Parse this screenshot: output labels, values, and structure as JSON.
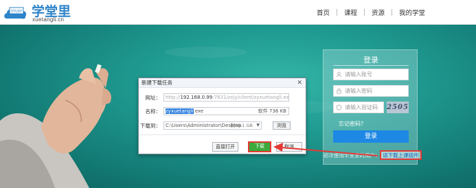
{
  "header": {
    "logo_badge": "STUDY",
    "logo_title": "学堂里",
    "logo_domain": "xuetangli.cn",
    "nav": [
      "首页",
      "课程",
      "资源",
      "我的学堂"
    ]
  },
  "login": {
    "title": "登录",
    "account_placeholder": "请输入账号",
    "password_placeholder": "请输入密码",
    "captcha_placeholder": "请输入验证码",
    "captcha_text": "2505",
    "forgot": "忘记密码？",
    "login_button": "登录",
    "first_use": "初次使用学堂里的用户：",
    "plugin_link": "请下载上课插件"
  },
  "dialog": {
    "title": "新建下载任务",
    "url_label": "网址：",
    "url_prefix": "http://",
    "url_host": "192.168.0.99",
    "url_rest": ":7831/zxjy/client/zyxuetangli.exe",
    "name_label": "名称：",
    "name_selected": "zyxuetangli",
    "name_ext": ".exe",
    "file_size": "软件 736 KB",
    "save_label": "下载到：",
    "save_path": "C:\\Users\\Administrator\\Desktop",
    "disk_space": "剩60.1 GB",
    "browse_button": "浏览",
    "open_button": "直接打开",
    "download_button": "下载",
    "cancel_button": "取消"
  },
  "colors": {
    "accent_blue": "#1e88e5",
    "highlight_red": "#e53935",
    "download_green": "#3caa3c",
    "board_teal": "#1f9a90"
  }
}
